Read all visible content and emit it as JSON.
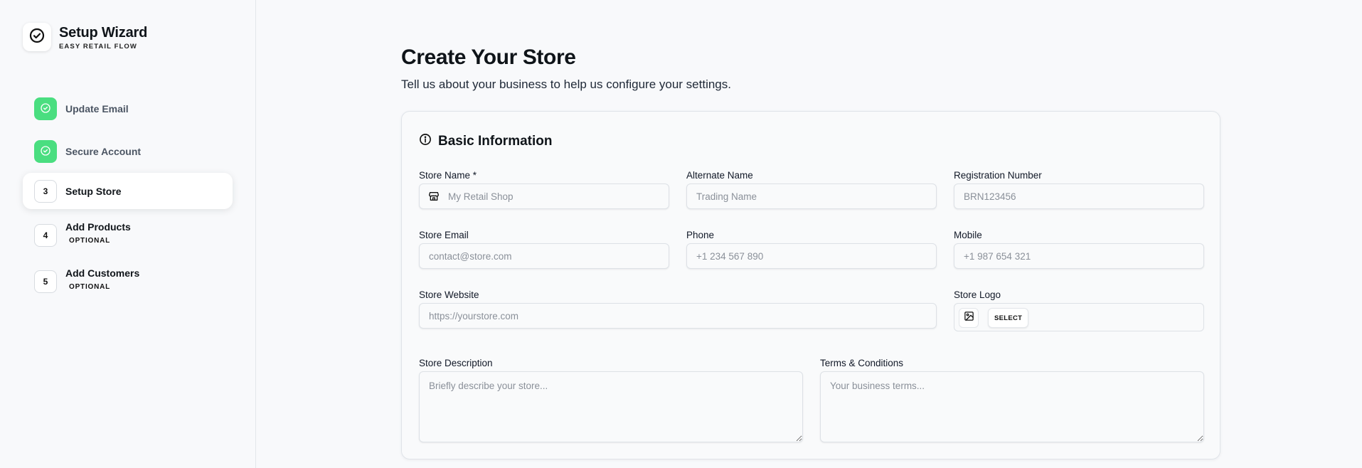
{
  "brand": {
    "title": "Setup Wizard",
    "subtitle": "EASY RETAIL FLOW",
    "icon": "check-circle-icon"
  },
  "steps": [
    {
      "label": "Update Email",
      "status": "completed",
      "badge": ""
    },
    {
      "label": "Secure Account",
      "status": "completed",
      "badge": ""
    },
    {
      "label": "Setup Store",
      "status": "current",
      "badge": "3"
    },
    {
      "label": "Add Products",
      "status": "pending",
      "badge": "4",
      "optional": "OPTIONAL"
    },
    {
      "label": "Add Customers",
      "status": "pending",
      "badge": "5",
      "optional": "OPTIONAL"
    }
  ],
  "page": {
    "title": "Create Your Store",
    "subtitle": "Tell us about your business to help us configure your settings."
  },
  "section": {
    "title": "Basic Information",
    "icon": "info-icon"
  },
  "fields": {
    "store_name": {
      "label": "Store Name *",
      "placeholder": "My Retail Shop",
      "value": ""
    },
    "alternate_name": {
      "label": "Alternate Name",
      "placeholder": "Trading Name",
      "value": ""
    },
    "registration_number": {
      "label": "Registration Number",
      "placeholder": "BRN123456",
      "value": ""
    },
    "store_email": {
      "label": "Store Email",
      "placeholder": "contact@store.com",
      "value": ""
    },
    "phone": {
      "label": "Phone",
      "placeholder": "+1 234 567 890",
      "value": ""
    },
    "mobile": {
      "label": "Mobile",
      "placeholder": "+1 987 654 321",
      "value": ""
    },
    "store_website": {
      "label": "Store Website",
      "placeholder": "https://yourstore.com",
      "value": ""
    },
    "store_logo": {
      "label": "Store Logo",
      "button": "SELECT"
    },
    "store_description": {
      "label": "Store Description",
      "placeholder": "Briefly describe your store...",
      "value": ""
    },
    "terms": {
      "label": "Terms & Conditions",
      "placeholder": "Your business terms...",
      "value": ""
    }
  },
  "colors": {
    "completed": "#4ade80",
    "background": "#f8f9fb",
    "text": "#0f1419"
  }
}
